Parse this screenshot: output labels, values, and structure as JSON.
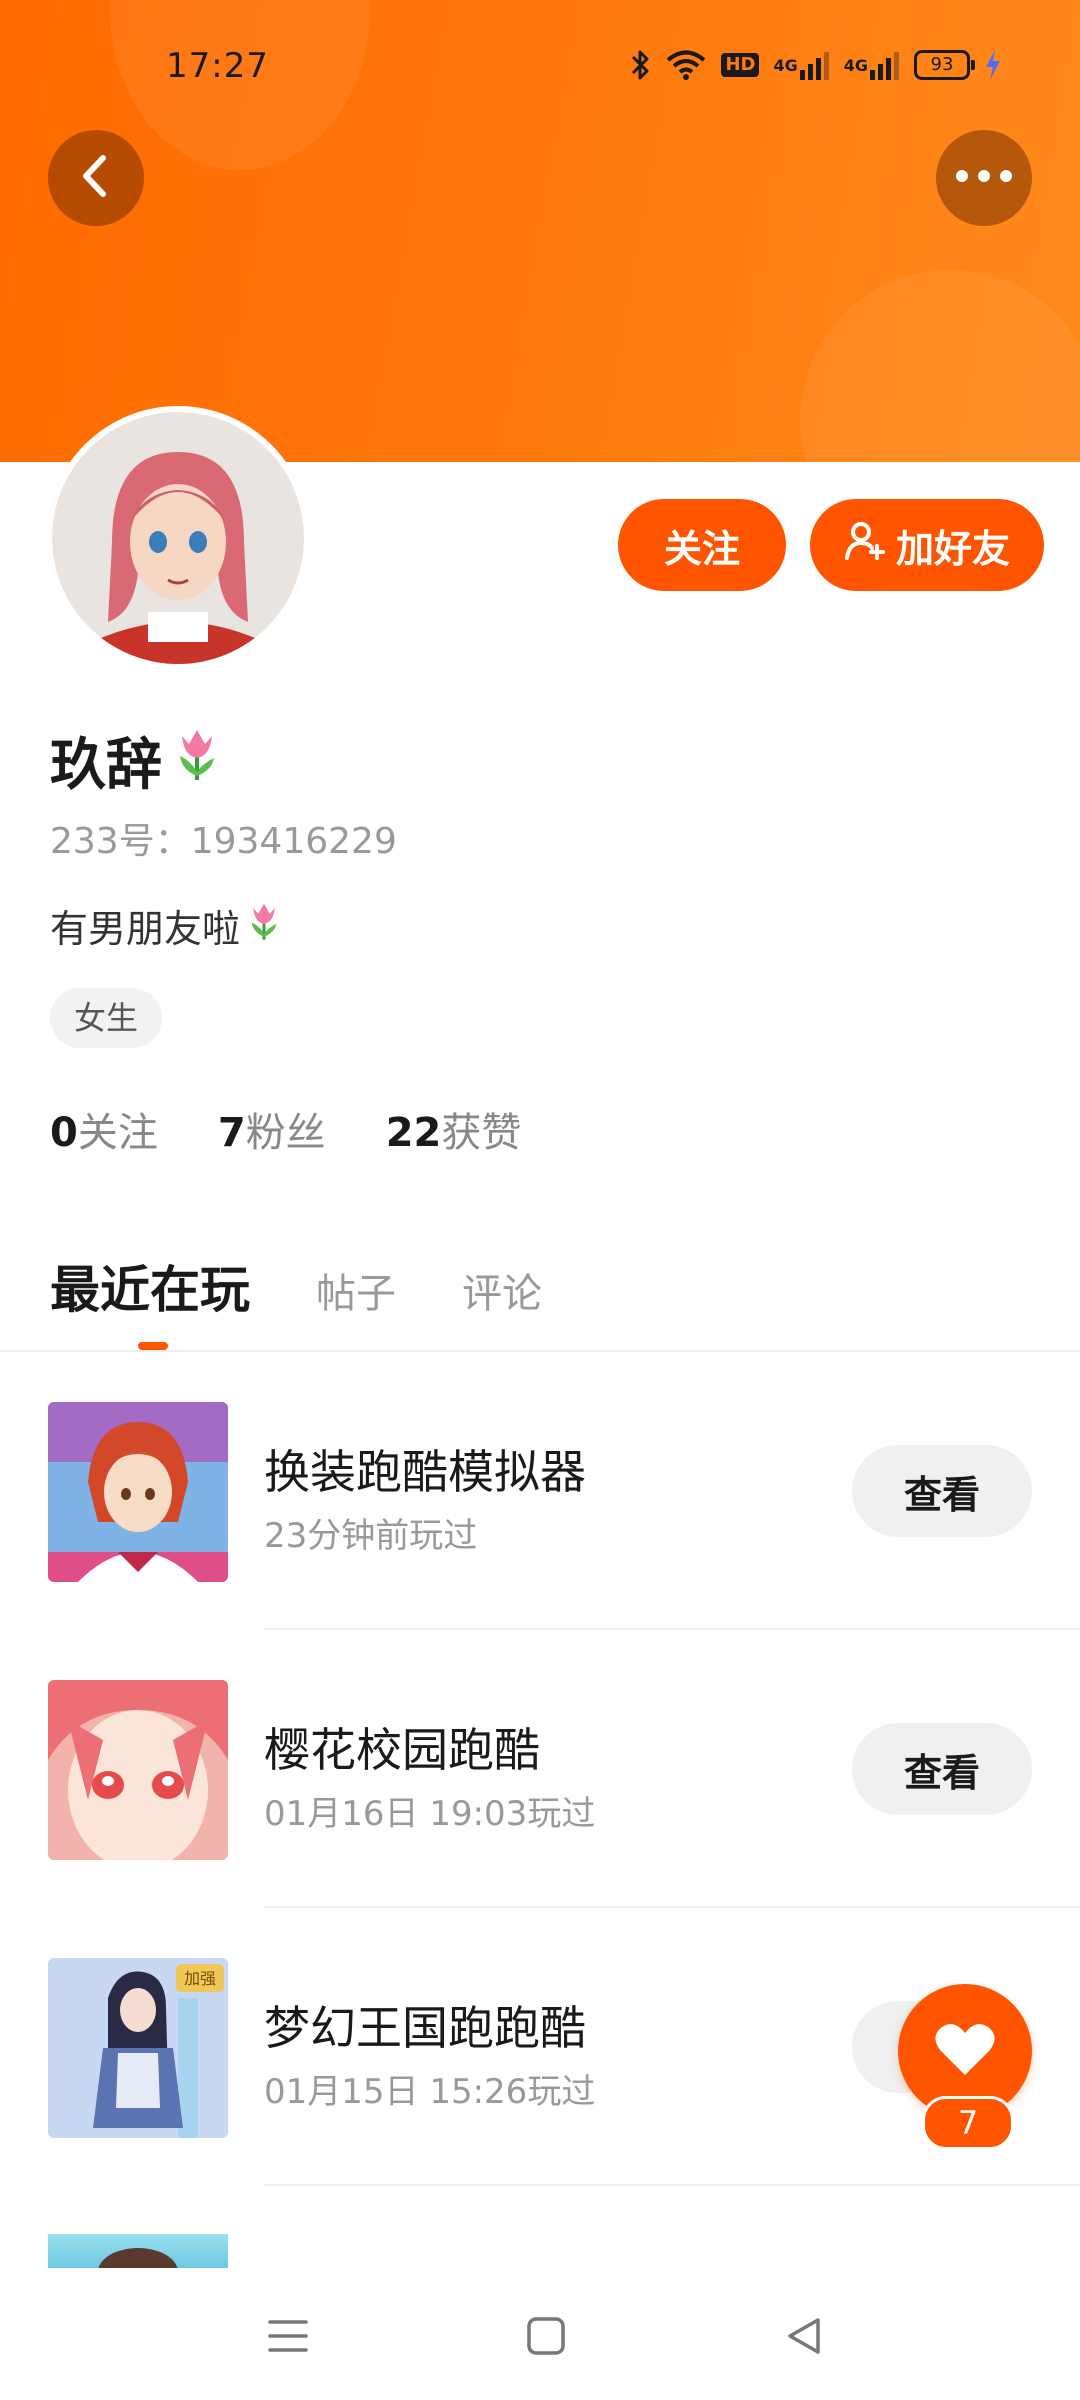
{
  "status_bar": {
    "time": "17:27",
    "hd_label": "HD",
    "sim1_label": "4G",
    "sim2_label": "4G",
    "battery": "93"
  },
  "header": {
    "back_icon": "chevron-left-icon",
    "more_icon": "more-dots-icon"
  },
  "profile": {
    "follow_label": "关注",
    "add_friend_label": "加好友",
    "username": "玖辞",
    "uid": "233号：193416229",
    "bio": "有男朋友啦",
    "gender_tag": "女生",
    "stats": [
      {
        "num": "0",
        "label": "关注"
      },
      {
        "num": "7",
        "label": "粉丝"
      },
      {
        "num": "22",
        "label": "获赞"
      }
    ]
  },
  "tabs": [
    {
      "label": "最近在玩"
    },
    {
      "label": "帖子"
    },
    {
      "label": "评论"
    }
  ],
  "games": [
    {
      "title": "换装跑酷模拟器",
      "time": "23分钟前玩过",
      "button": "查看"
    },
    {
      "title": "樱花校园跑酷",
      "time": "01月16日 19:03玩过",
      "button": "查看"
    },
    {
      "title": "梦幻王国跑跑酷",
      "time": "01月15日 15:26玩过",
      "button": "查看",
      "badge": "加强"
    }
  ],
  "like_fab": {
    "count": "7"
  },
  "colors": {
    "accent": "#ff5500",
    "header_gradient_start": "#ff6a00",
    "header_gradient_end": "#ff8a1c"
  }
}
